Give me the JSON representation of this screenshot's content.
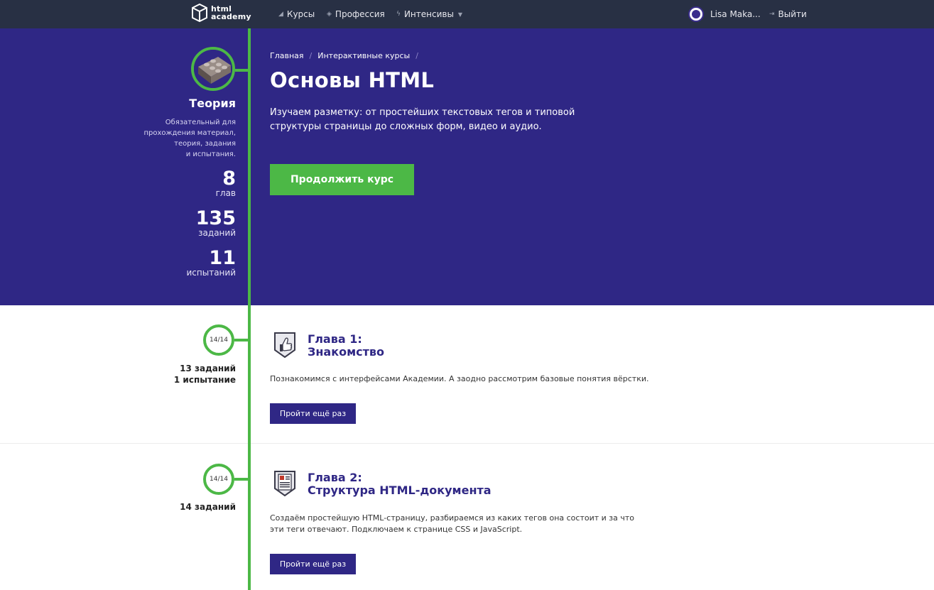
{
  "topbar": {
    "logo_line1": "html",
    "logo_line2": "academy",
    "nav": [
      {
        "label": "Курсы",
        "icon": "courses-icon"
      },
      {
        "label": "Профессия",
        "icon": "graduation-cap-icon"
      },
      {
        "label": "Интенсивы",
        "icon": "lightning-icon"
      }
    ],
    "user_name": "Lisa Maka...",
    "logout_label": "Выйти"
  },
  "sidebar": {
    "title": "Теория",
    "description_lines": [
      "Обязательный для",
      "прохождения материал,",
      "теория, задания",
      "и испытания."
    ],
    "stats": [
      {
        "num": "8",
        "label": "глав"
      },
      {
        "num": "135",
        "label": "заданий"
      },
      {
        "num": "11",
        "label": "испытаний"
      }
    ]
  },
  "breadcrumb": [
    "Главная",
    "Интерактивные курсы"
  ],
  "hero": {
    "title": "Основы HTML",
    "lead": "Изучаем разметку: от простейших текстовых тегов и типовой структуры страницы до сложных форм, видео и аудио.",
    "cta": "Продолжить курс"
  },
  "chapters": [
    {
      "progress": "14/14",
      "meta_lines": [
        "13 заданий",
        "1 испытание"
      ],
      "title_line1": "Глава 1:",
      "title_line2": "Знакомство",
      "icon": "thumbs-up-shield-icon",
      "description": "Познакомимся с интерфейсами Академии. А заодно рассмотрим базовые понятия вёрстки.",
      "button": "Пройти ещё раз"
    },
    {
      "progress": "14/14",
      "meta_lines": [
        "14 заданий"
      ],
      "title_line1": "Глава 2:",
      "title_line2": "Структура HTML-документа",
      "icon": "document-shield-icon",
      "description": "Создаём простейшую HTML-страницу, разбираемся из каких тегов она состоит и за что эти теги отвечают. Подключаем к странице CSS и JavaScript.",
      "button": "Пройти ещё раз"
    }
  ],
  "colors": {
    "brand_purple": "#2f2785",
    "accent_green": "#4cb846",
    "topbar": "#283044"
  }
}
